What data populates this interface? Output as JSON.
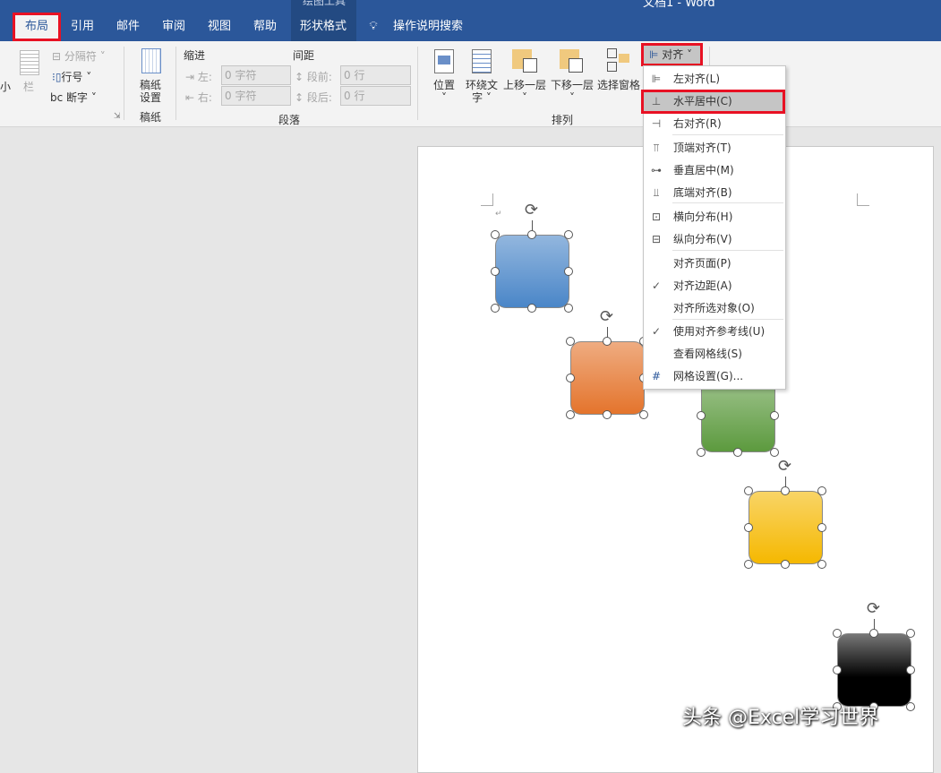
{
  "window": {
    "title": "文档1 - Word",
    "context_tab_group": "绘图工具"
  },
  "tabs": [
    {
      "label": "布局",
      "active": true
    },
    {
      "label": "引用"
    },
    {
      "label": "邮件"
    },
    {
      "label": "审阅"
    },
    {
      "label": "视图"
    },
    {
      "label": "帮助"
    },
    {
      "label": "形状格式"
    }
  ],
  "search": {
    "label": "操作说明搜索",
    "icon": "lightbulb-icon"
  },
  "ribbon": {
    "page_setup": {
      "size_partial": "小",
      "columns": "栏",
      "breaks": "分隔符",
      "line_numbers": "行号",
      "hyphenation": "断字"
    },
    "draft": {
      "button": "稿纸\n设置",
      "group": "稿纸"
    },
    "paragraph": {
      "indent": "缩进",
      "spacing": "间距",
      "left_label": "左:",
      "left_value": "0 字符",
      "right_label": "右:",
      "right_value": "0 字符",
      "before_label": "段前:",
      "before_value": "0 行",
      "after_label": "段后:",
      "after_value": "0 行",
      "group": "段落"
    },
    "arrange": {
      "position": "位置",
      "wrap_text_1": "环绕文",
      "wrap_text_2": "字",
      "bring_forward": "上移一层",
      "send_backward": "下移一层",
      "selection_pane": "选择窗格",
      "align": "对齐",
      "group": "排列"
    }
  },
  "align_menu": {
    "items": [
      {
        "label": "左对齐(L)",
        "icon": "align-left-icon"
      },
      {
        "label": "水平居中(C)",
        "icon": "align-center-icon",
        "highlighted": true
      },
      {
        "label": "右对齐(R)",
        "icon": "align-right-icon"
      },
      {
        "label": "顶端对齐(T)",
        "icon": "align-top-icon"
      },
      {
        "label": "垂直居中(M)",
        "icon": "align-middle-icon"
      },
      {
        "label": "底端对齐(B)",
        "icon": "align-bottom-icon"
      },
      {
        "label": "横向分布(H)",
        "icon": "distribute-horizontal-icon"
      },
      {
        "label": "纵向分布(V)",
        "icon": "distribute-vertical-icon"
      },
      {
        "label": "对齐页面(P)"
      },
      {
        "label": "对齐边距(A)",
        "checked": true
      },
      {
        "label": "对齐所选对象(O)"
      },
      {
        "label": "使用对齐参考线(U)",
        "checked": true
      },
      {
        "label": "查看网格线(S)"
      },
      {
        "label": "网格设置(G)...",
        "icon": "grid-icon"
      }
    ]
  },
  "shapes": [
    {
      "color": "#4a86c8"
    },
    {
      "color": "#e4742c"
    },
    {
      "color": "#5c9a3e"
    },
    {
      "color": "#f5b800"
    },
    {
      "color": "#1a1a1a"
    }
  ],
  "watermark": "头条 @Excel学习世界",
  "colors": {
    "accent": "#2b579a",
    "highlight": "#e81123"
  }
}
